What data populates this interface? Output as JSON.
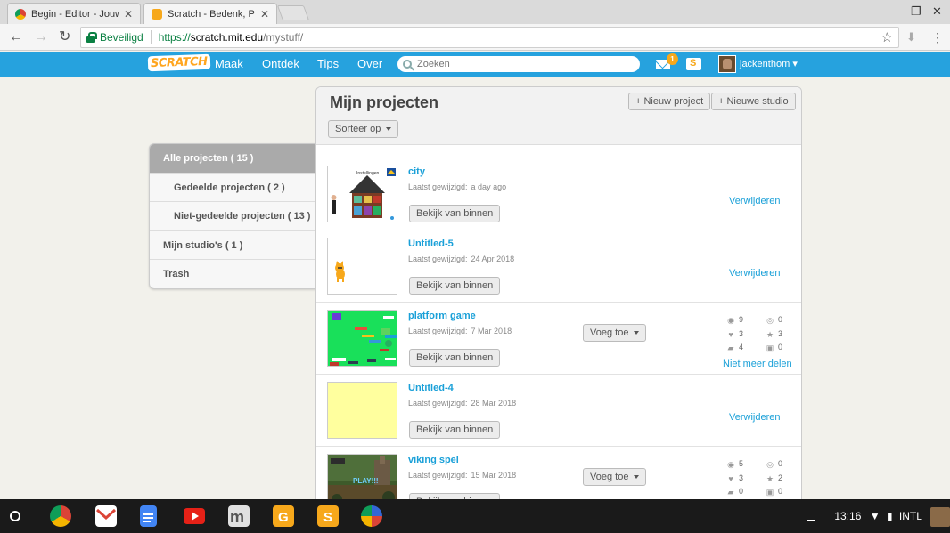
{
  "browser": {
    "tabs": [
      {
        "title": "Begin - Editor - JouwWeb",
        "active": false
      },
      {
        "title": "Scratch - Bedenk, Programmeer, Deel",
        "active": true
      }
    ],
    "address": {
      "secure_label": "Beveiligd",
      "scheme": "https://",
      "host": "scratch.mit.edu",
      "path": "/mystuff/"
    }
  },
  "scratch_nav": {
    "logo": "SCRATCH",
    "links": [
      "Maak",
      "Ontdek",
      "Tips",
      "Over"
    ],
    "search_placeholder": "Zoeken",
    "message_count": "1",
    "username": "jackenthom"
  },
  "sidebar": {
    "items": [
      {
        "label": "Alle projecten ( 15 )",
        "active": true,
        "sub": false
      },
      {
        "label": "Gedeelde projecten ( 2 )",
        "active": false,
        "sub": true
      },
      {
        "label": "Niet-gedeelde projecten ( 13 )",
        "active": false,
        "sub": true
      },
      {
        "label": "Mijn studio's ( 1 )",
        "active": false,
        "sub": false
      },
      {
        "label": "Trash",
        "active": false,
        "sub": false
      }
    ]
  },
  "panel": {
    "title": "Mijn projecten",
    "new_project": "+ Nieuw project",
    "new_studio": "+ Nieuwe studio",
    "sort_by": "Sorteer op"
  },
  "labels": {
    "last_modified": "Laatst gewijzigd:",
    "see_inside": "Bekijk van binnen",
    "delete": "Verwijderen",
    "add_to": "Voeg toe",
    "unshare": "Niet meer delen"
  },
  "projects": [
    {
      "title": "city",
      "modified": "a day ago",
      "shared": false
    },
    {
      "title": "Untitled-5",
      "modified": "24 Apr 2018",
      "shared": false
    },
    {
      "title": "platform game",
      "modified": "7 Mar 2018",
      "shared": true,
      "views": "9",
      "loves": "3",
      "comments": "4",
      "remixes": "0",
      "favorites": "3",
      "studios": "0"
    },
    {
      "title": "Untitled-4",
      "modified": "28 Mar 2018",
      "shared": false
    },
    {
      "title": "viking spel",
      "modified": "15 Mar 2018",
      "shared": true,
      "views": "5",
      "loves": "3",
      "comments": "0",
      "remixes": "0",
      "favorites": "2",
      "studios": "0"
    }
  ],
  "thumb_texts": {
    "city_caption": "Instellingen",
    "viking_caption": "PLAY!!!"
  },
  "taskbar": {
    "time": "13:16",
    "keyboard": "INTL"
  },
  "colors": {
    "scratch_blue": "#26a2de",
    "link_blue": "#1aa0d8",
    "badge_orange": "#f7a81b"
  }
}
